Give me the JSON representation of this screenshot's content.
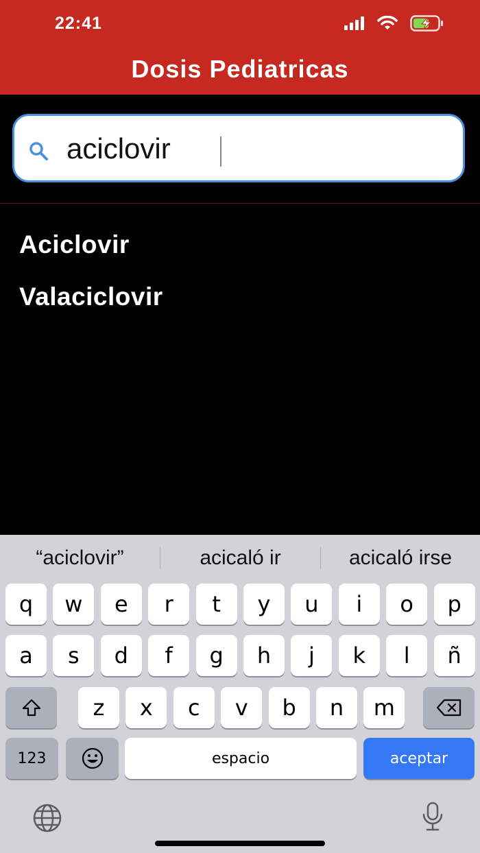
{
  "status_bar": {
    "time": "22:41"
  },
  "header": {
    "title": "Dosis Pediatricas"
  },
  "search": {
    "value": "aciclovir"
  },
  "results": [
    {
      "label": "Aciclovir"
    },
    {
      "label": "Valaciclovir"
    }
  ],
  "keyboard": {
    "suggestions": [
      "“aciclovir”",
      "acicaló ir",
      "acicaló irse"
    ],
    "row1": [
      "q",
      "w",
      "e",
      "r",
      "t",
      "y",
      "u",
      "i",
      "o",
      "p"
    ],
    "row2": [
      "a",
      "s",
      "d",
      "f",
      "g",
      "h",
      "j",
      "k",
      "l",
      "ñ"
    ],
    "row3": [
      "z",
      "x",
      "c",
      "v",
      "b",
      "n",
      "m"
    ],
    "numbers_label": "123",
    "space_label": "espacio",
    "return_label": "aceptar"
  },
  "colors": {
    "header": "#c6291f",
    "search_border": "#4a90e2",
    "accept": "#3478f6"
  }
}
